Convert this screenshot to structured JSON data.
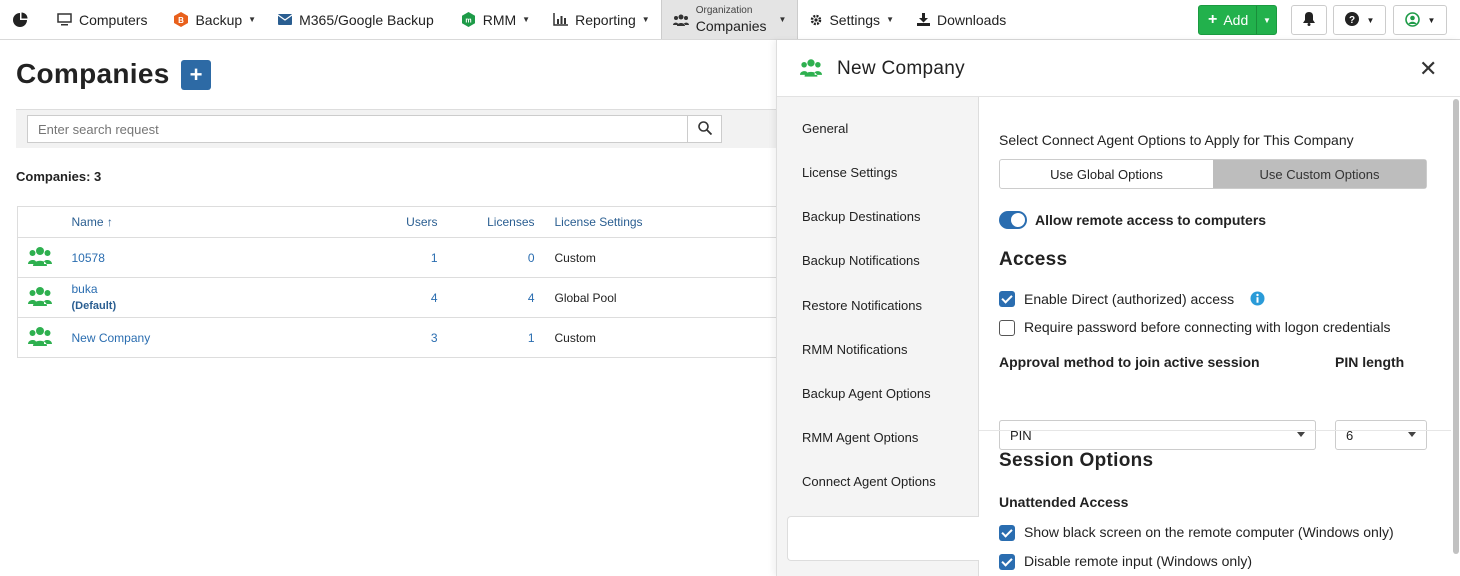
{
  "nav": {
    "items": [
      {
        "label": "Computers",
        "icon": "monitor-icon"
      },
      {
        "label": "Backup",
        "icon": "backup-icon"
      },
      {
        "label": "M365/Google Backup",
        "icon": "envelope-icon"
      },
      {
        "label": "RMM",
        "icon": "rmm-icon"
      },
      {
        "label": "Reporting",
        "icon": "bar-chart-icon"
      }
    ],
    "active_small": "Organization",
    "active_big": "Companies",
    "settings": "Settings",
    "downloads": "Downloads",
    "add": "Add"
  },
  "page": {
    "title": "Companies",
    "search_placeholder": "Enter search request",
    "count_label": "Companies: 3"
  },
  "table": {
    "headers": {
      "name": "Name",
      "users": "Users",
      "licenses": "Licenses",
      "license_settings": "License Settings"
    },
    "rows": [
      {
        "name": "10578",
        "sub": "",
        "users": "1",
        "licenses": "0",
        "license_settings": "Custom"
      },
      {
        "name": "buka",
        "sub": "(Default)",
        "users": "4",
        "licenses": "4",
        "license_settings": "Global Pool"
      },
      {
        "name": "New Company",
        "sub": "",
        "users": "3",
        "licenses": "1",
        "license_settings": "Custom"
      }
    ]
  },
  "panel": {
    "title": "New Company",
    "tabs": [
      "General",
      "License Settings",
      "Backup Destinations",
      "Backup Notifications",
      "Restore Notifications",
      "RMM Notifications",
      "Backup Agent Options",
      "RMM Agent Options",
      "Connect Agent Options"
    ],
    "active_tab": 8,
    "intro": "Select Connect Agent Options to Apply for This Company",
    "seg_global": "Use Global Options",
    "seg_custom": "Use Custom Options",
    "allow_remote": "Allow remote access to computers",
    "access_title": "Access",
    "enable_direct": "Enable Direct (authorized) access",
    "require_password": "Require password before connecting with logon credentials",
    "approval_label": "Approval method to join active session",
    "approval_value": "PIN",
    "pin_label": "PIN length",
    "pin_value": "6",
    "session_title": "Session Options",
    "unattended_title": "Unattended Access",
    "black_screen": "Show black screen on the remote computer (Windows only)",
    "disable_input": "Disable remote input (Windows only)"
  },
  "colors": {
    "accent_blue": "#2a6db0",
    "add_green": "#22b14c",
    "company_icon_green": "#2eb04f"
  }
}
